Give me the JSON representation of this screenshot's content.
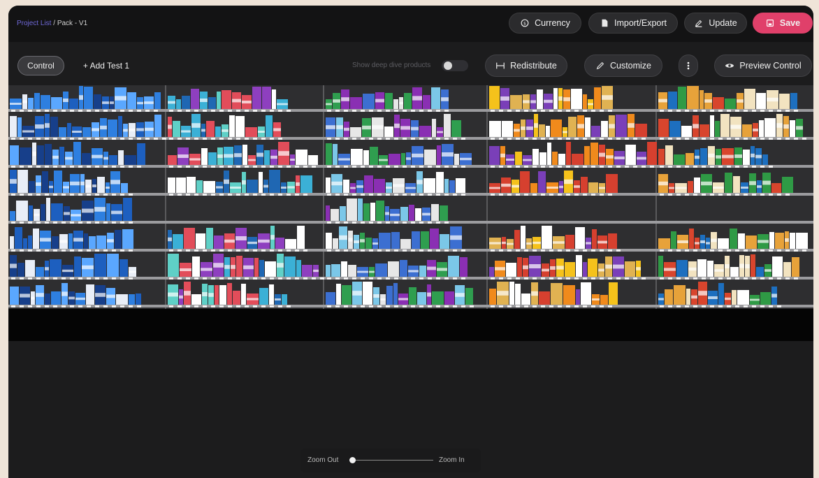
{
  "breadcrumb": {
    "project_list": "Project List",
    "separator": " / ",
    "current": "Pack - V1"
  },
  "toolbar": {
    "currency": "Currency",
    "import_export": "Import/Export",
    "update": "Update",
    "save": "Save"
  },
  "subbar": {
    "control_tab": "Control",
    "add_test": "+ Add Test 1",
    "deep_dive_label": "Show deep dive products",
    "deep_dive_enabled": false,
    "redistribute": "Redistribute",
    "customize": "Customize",
    "preview": "Preview Control"
  },
  "planogram": {
    "bays": 5,
    "shelves_per_bay": 8
  },
  "zoom": {
    "out": "Zoom Out",
    "in": "Zoom In",
    "level": 0
  },
  "colors": {
    "accent": "#e0406a",
    "link": "#6f68d8",
    "canvas": "#1c1c1d"
  }
}
